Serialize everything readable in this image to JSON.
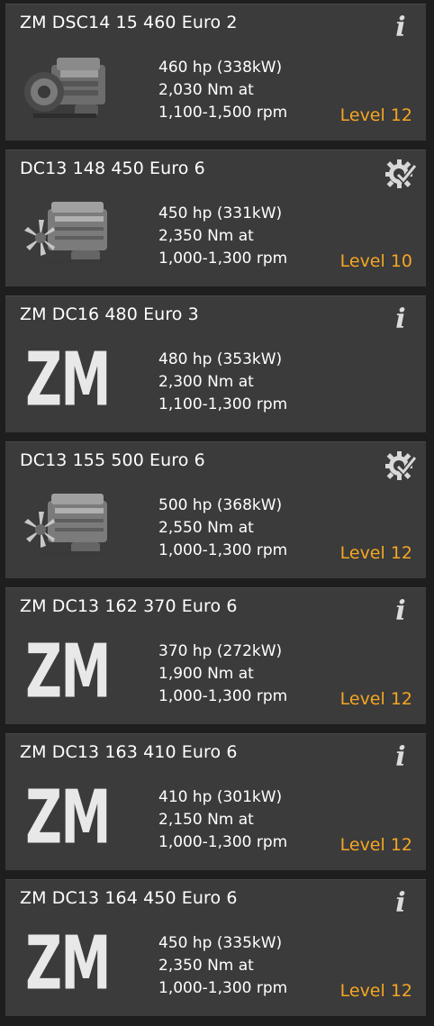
{
  "engines": [
    {
      "name": "ZM DSC14 15 460 Euro 2",
      "power": "460 hp (338kW)",
      "torque": "2,030 Nm at",
      "rpm": "1,100-1,500 rpm",
      "level": "Level 12",
      "status_icon": "info-icon",
      "thumbnail": "engine-image"
    },
    {
      "name": "DC13 148 450 Euro 6",
      "power": "450 hp (331kW)",
      "torque": "2,350 Nm at",
      "rpm": "1,000-1,300 rpm",
      "level": "Level 10",
      "status_icon": "gear-check-icon",
      "thumbnail": "engine-image"
    },
    {
      "name": "ZM DC16 480 Euro 3",
      "power": "480 hp (353kW)",
      "torque": "2,300 Nm at",
      "rpm": "1,100-1,300 rpm",
      "level": "",
      "status_icon": "info-icon",
      "thumbnail": "zm-logo",
      "logo_text": "ZM"
    },
    {
      "name": "DC13 155 500 Euro 6",
      "power": "500 hp (368kW)",
      "torque": "2,550 Nm at",
      "rpm": "1,000-1,300 rpm",
      "level": "Level 12",
      "status_icon": "gear-check-icon",
      "thumbnail": "engine-image"
    },
    {
      "name": "ZM DC13 162 370 Euro 6",
      "power": "370 hp (272kW)",
      "torque": "1,900 Nm at",
      "rpm": "1,000-1,300 rpm",
      "level": "Level 12",
      "status_icon": "info-icon",
      "thumbnail": "zm-logo",
      "logo_text": "ZM"
    },
    {
      "name": "ZM DC13 163 410 Euro 6",
      "power": "410 hp (301kW)",
      "torque": "2,150 Nm at",
      "rpm": "1,000-1,300 rpm",
      "level": "Level 12",
      "status_icon": "info-icon",
      "thumbnail": "zm-logo",
      "logo_text": "ZM"
    },
    {
      "name": "ZM DC13 164 450 Euro 6",
      "power": "450 hp (335kW)",
      "torque": "2,350 Nm at",
      "rpm": "1,000-1,300 rpm",
      "level": "Level 12",
      "status_icon": "info-icon",
      "thumbnail": "zm-logo",
      "logo_text": "ZM"
    }
  ],
  "colors": {
    "background": "#1e1e1e",
    "card": "#3b3b3b",
    "level": "#f5a623",
    "text": "#ffffff",
    "icon": "#dcdcdc"
  }
}
